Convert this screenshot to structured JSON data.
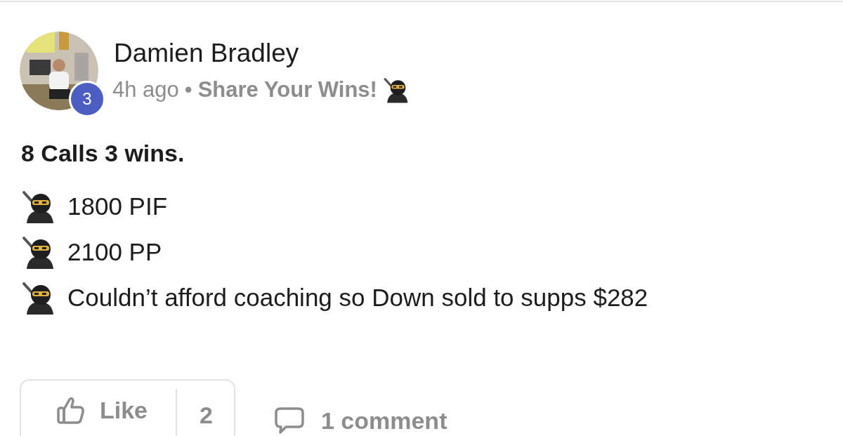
{
  "post": {
    "author": "Damien Bradley",
    "badge": "3",
    "time": "4h ago",
    "separator": "•",
    "group": "Share Your Wins!",
    "title": "8 Calls 3 wins.",
    "lines": [
      "1800 PIF",
      "2100 PP",
      "Couldn’t afford coaching so Down sold to supps $282"
    ],
    "like_label": "Like",
    "like_count": "2",
    "comments": "1 comment"
  }
}
